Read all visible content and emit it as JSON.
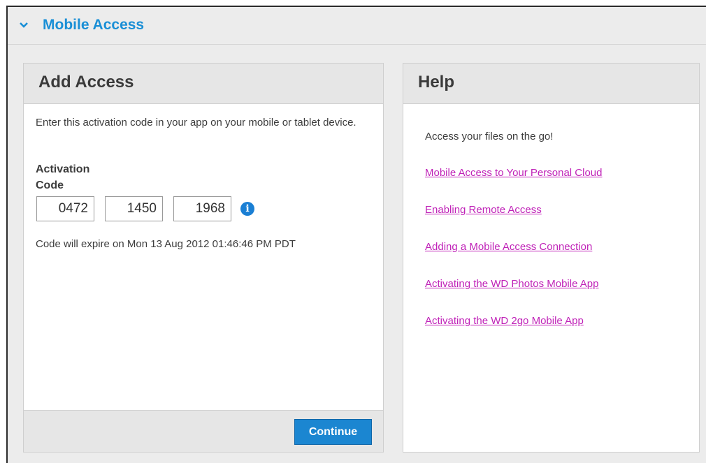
{
  "header": {
    "title": "Mobile Access",
    "chevron_icon": "chevron-down-icon",
    "accent_color": "#1a8fd6"
  },
  "add_access": {
    "title": "Add Access",
    "instructions": "Enter this activation code in your app on your mobile or tablet device.",
    "code_label": "Activation Code",
    "code_parts": [
      "0472",
      "1450",
      "1968"
    ],
    "info_icon": "info-icon",
    "expire_text": "Code will expire on Mon 13 Aug 2012 01:46:46 PM PDT",
    "continue_label": "Continue",
    "button_color": "#1b86d1"
  },
  "help": {
    "title": "Help",
    "intro": "Access your files on the go!",
    "links": [
      "Mobile Access to Your Personal Cloud",
      "Enabling Remote Access",
      "Adding a Mobile Access Connection",
      "Activating the WD Photos Mobile App",
      "Activating the WD 2go Mobile App"
    ],
    "link_color": "#c023b8"
  }
}
